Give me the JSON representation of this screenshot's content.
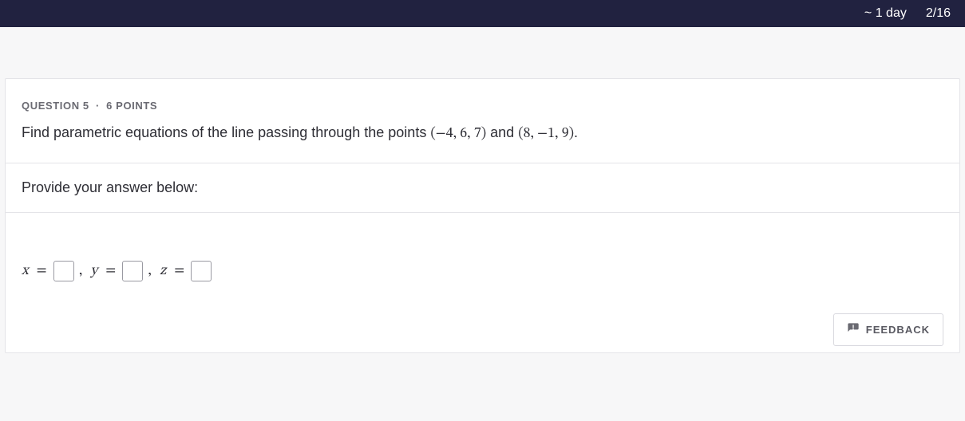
{
  "topbar": {
    "time_left": "~ 1 day",
    "progress": "2/16"
  },
  "question": {
    "label": "QUESTION 5",
    "separator": "·",
    "points": "6 POINTS",
    "prompt_prefix": "Find parametric equations of the line passing through the points ",
    "point_a": "(−4, 6, 7)",
    "prompt_mid": " and ",
    "point_b": "(8, −1, 9)",
    "prompt_suffix": "."
  },
  "answer": {
    "instruction": "Provide your answer below:",
    "eqs": {
      "x_var": "x",
      "y_var": "y",
      "z_var": "z",
      "equals": "=",
      "comma": ","
    }
  },
  "feedback": {
    "label": "FEEDBACK"
  }
}
